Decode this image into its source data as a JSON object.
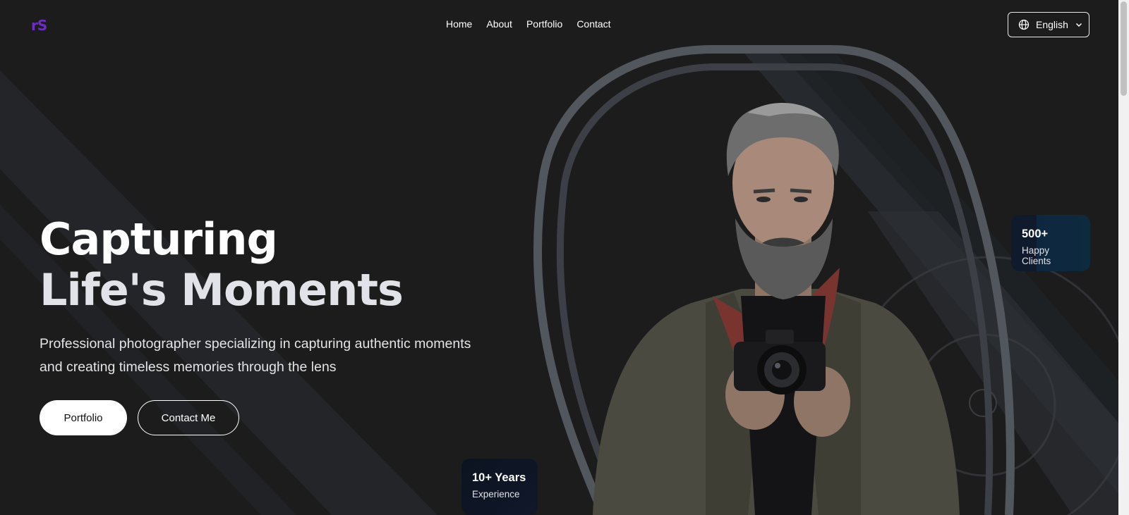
{
  "header": {
    "logo": "rS",
    "nav": [
      {
        "label": "Home"
      },
      {
        "label": "About"
      },
      {
        "label": "Portfolio"
      },
      {
        "label": "Contact"
      }
    ],
    "language": {
      "label": "English",
      "icon": "globe-icon"
    }
  },
  "hero": {
    "title_line1": "Capturing",
    "title_line2": "Life's Moments",
    "subtitle": "Professional photographer specializing in capturing authentic moments and creating timeless memories through the lens",
    "primary_button": "Portfolio",
    "secondary_button": "Contact Me"
  },
  "stats": {
    "experience": {
      "value": "10+ Years",
      "label": "Experience"
    },
    "clients": {
      "value": "500+",
      "label": "Happy Clients"
    }
  },
  "colors": {
    "background": "#1c1c1d",
    "accent_logo": "#6b2fc0",
    "card": "#0f1a2c"
  }
}
